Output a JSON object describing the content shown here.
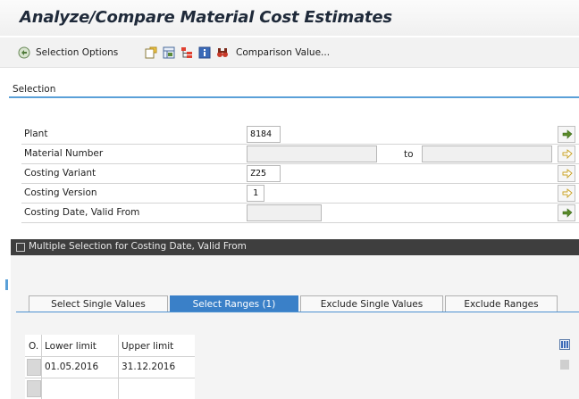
{
  "window": {
    "title": "Analyze/Compare Material Cost Estimates"
  },
  "toolbar": {
    "selection_options_label": "Selection Options",
    "comparison_value_label": "Comparison Value..."
  },
  "selection": {
    "heading": "Selection",
    "fields": [
      {
        "label": "Plant",
        "value": "8184"
      },
      {
        "label": "Material Number",
        "value": "",
        "to_label": "to",
        "to_value": ""
      },
      {
        "label": "Costing Variant",
        "value": "Z25"
      },
      {
        "label": "Costing Version",
        "value": "1"
      },
      {
        "label": "Costing Date, Valid From",
        "value": ""
      }
    ]
  },
  "dialog": {
    "title": "Multiple Selection for Costing Date, Valid From",
    "tabs": [
      {
        "label": "Select Single Values",
        "active": false
      },
      {
        "label": "Select Ranges (1)",
        "active": true
      },
      {
        "label": "Exclude Single Values",
        "active": false
      },
      {
        "label": "Exclude Ranges",
        "active": false
      }
    ],
    "grid": {
      "col_option": "O.",
      "col_lower": "Lower limit",
      "col_upper": "Upper limit",
      "rows": [
        {
          "lower": "01.05.2016",
          "upper": "31.12.2016"
        },
        {
          "lower": "",
          "upper": ""
        }
      ]
    }
  },
  "colors": {
    "accent_blue": "#3a80c8",
    "section_line": "#5aa0d8",
    "dialog_header": "#3e3e3e"
  },
  "icons": [
    "execute-icon",
    "get-variant-icon",
    "layout-icon",
    "tree-icon",
    "info-icon",
    "binoculars-icon",
    "multiple-selection-icon",
    "column-settings-icon"
  ]
}
